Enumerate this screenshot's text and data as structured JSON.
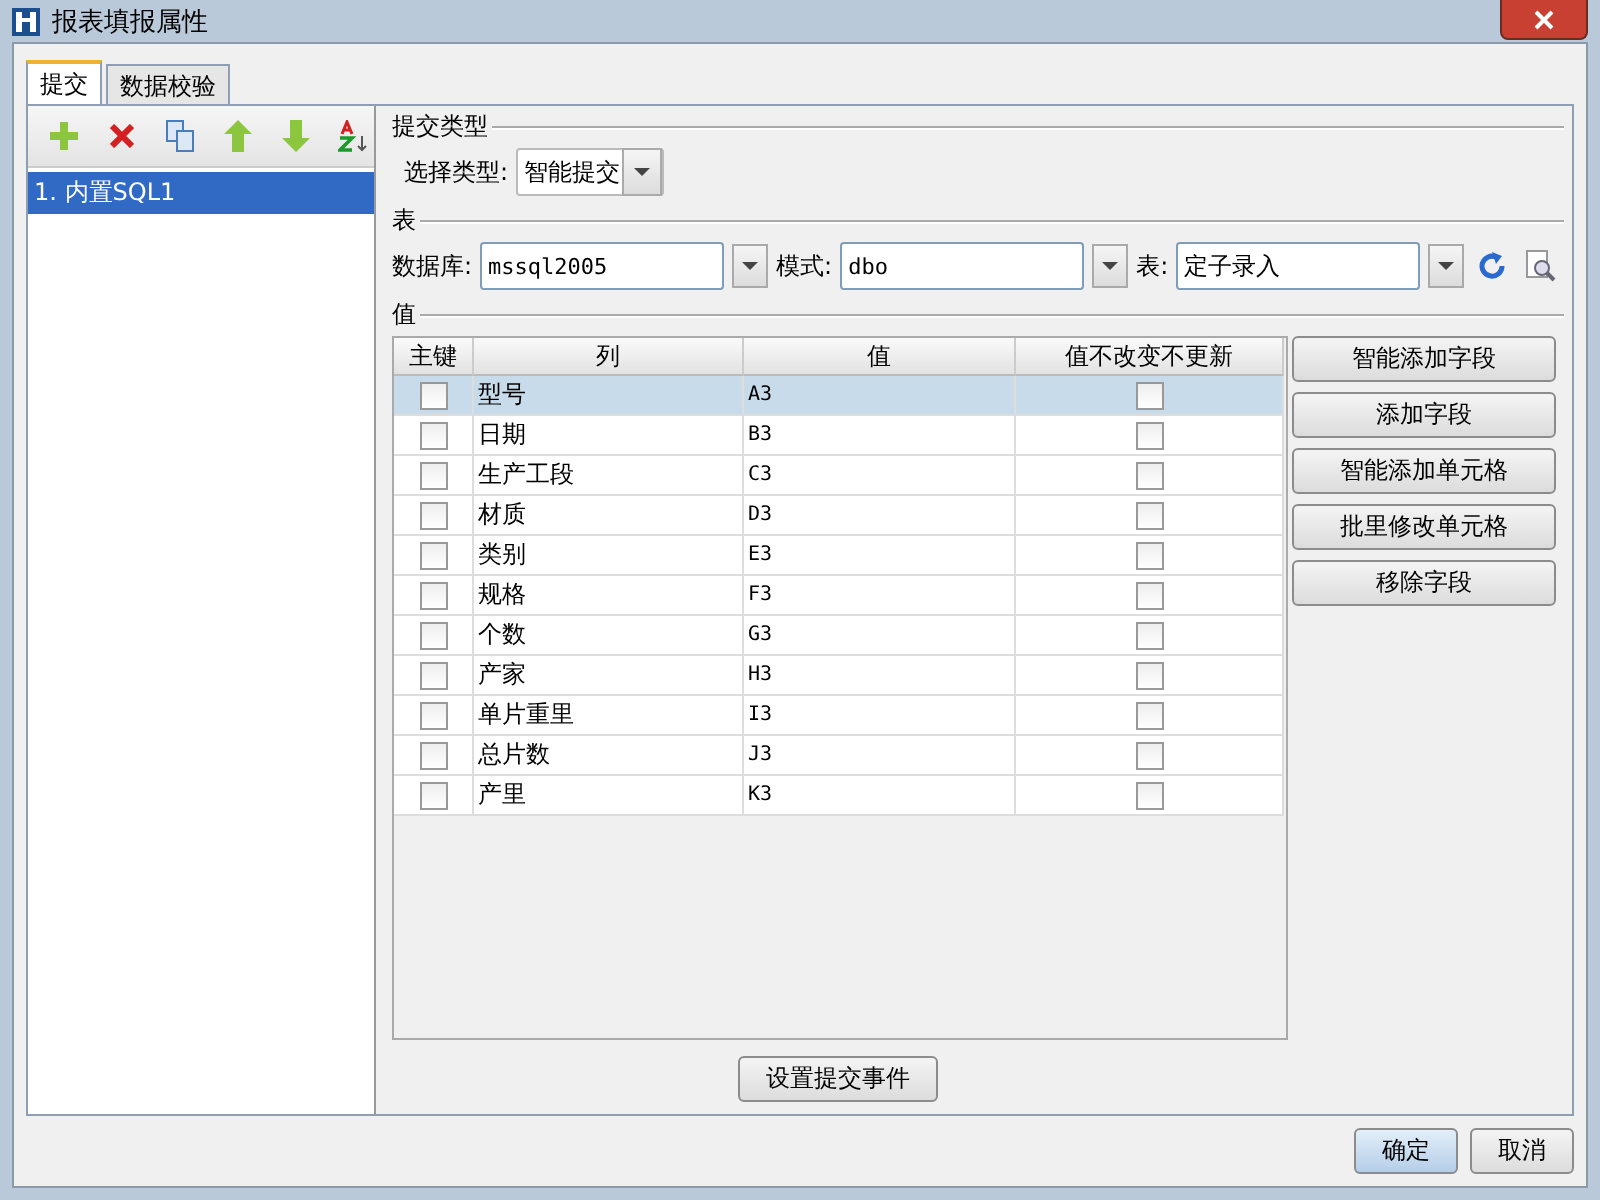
{
  "window": {
    "title": "报表填报属性"
  },
  "tabs": [
    {
      "label": "提交",
      "selected": true
    },
    {
      "label": "数据校验",
      "selected": false
    }
  ],
  "sidebar": {
    "items": [
      {
        "label": "1. 内置SQL1",
        "selected": true
      }
    ]
  },
  "submit_type": {
    "legend": "提交类型",
    "label": "选择类型:",
    "value": "智能提交"
  },
  "table_section": {
    "legend": "表",
    "fields": [
      {
        "label": "数据库:",
        "value": "mssql2005"
      },
      {
        "label": "模式:",
        "value": "dbo"
      },
      {
        "label": "表:",
        "value": "定子录入"
      }
    ]
  },
  "values_section": {
    "legend": "值",
    "columns": [
      "主键",
      "列",
      "值",
      "值不改变不更新"
    ],
    "rows": [
      {
        "key": false,
        "column": "型号",
        "value": "A3",
        "no_update": false,
        "selected": true
      },
      {
        "key": false,
        "column": "日期",
        "value": "B3",
        "no_update": false,
        "selected": false
      },
      {
        "key": false,
        "column": "生产工段",
        "value": "C3",
        "no_update": false,
        "selected": false
      },
      {
        "key": false,
        "column": "材质",
        "value": "D3",
        "no_update": false,
        "selected": false
      },
      {
        "key": false,
        "column": "类别",
        "value": "E3",
        "no_update": false,
        "selected": false
      },
      {
        "key": false,
        "column": "规格",
        "value": "F3",
        "no_update": false,
        "selected": false
      },
      {
        "key": false,
        "column": "个数",
        "value": "G3",
        "no_update": false,
        "selected": false
      },
      {
        "key": false,
        "column": "产家",
        "value": "H3",
        "no_update": false,
        "selected": false
      },
      {
        "key": false,
        "column": "单片重里",
        "value": "I3",
        "no_update": false,
        "selected": false
      },
      {
        "key": false,
        "column": "总片数",
        "value": "J3",
        "no_update": false,
        "selected": false
      },
      {
        "key": false,
        "column": "产里",
        "value": "K3",
        "no_update": false,
        "selected": false
      }
    ],
    "buttons": [
      "智能添加字段",
      "添加字段",
      "智能添加单元格",
      "批里修改单元格",
      "移除字段"
    ]
  },
  "event_button": "设置提交事件",
  "footer_buttons": [
    {
      "label": "确定",
      "default": true
    },
    {
      "label": "取消",
      "default": false
    }
  ]
}
